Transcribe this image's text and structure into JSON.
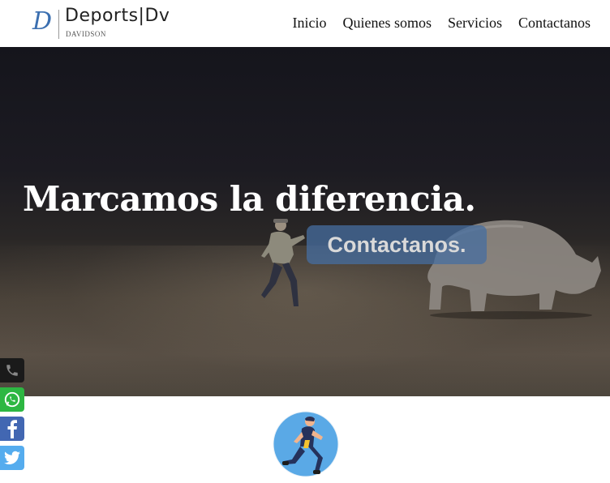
{
  "brand": {
    "name": "Deports|Dv",
    "subtitle": "DAVIDSON",
    "mark": "D"
  },
  "nav": {
    "items": [
      "Inicio",
      "Quienes somos",
      "Servicios",
      "Contactanos"
    ]
  },
  "hero": {
    "title": "Marcamos la diferencia.",
    "button_label": "Contactanos."
  },
  "social": {
    "icons": [
      "phone-icon",
      "whatsapp-icon",
      "facebook-icon",
      "twitter-icon"
    ]
  },
  "colors": {
    "whatsapp": "#2db742",
    "facebook": "#4267b2",
    "twitter": "#55acee",
    "button": "#466ea0"
  }
}
